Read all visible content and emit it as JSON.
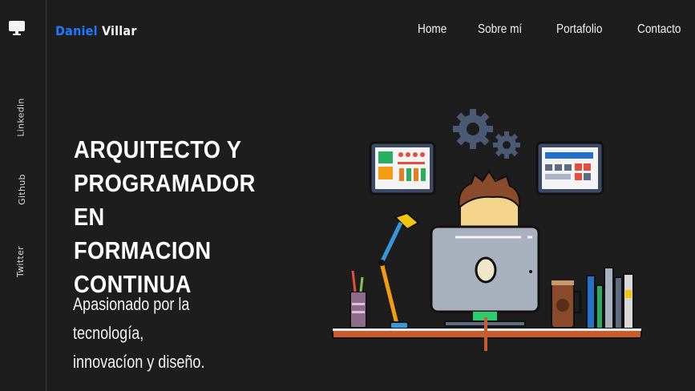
{
  "sidebar": {
    "logo_icon": "monitor-icon",
    "links": [
      {
        "label": "Linkedin"
      },
      {
        "label": "Github"
      },
      {
        "label": "Twitter"
      }
    ]
  },
  "header": {
    "brand_first": "Daniel",
    "brand_last": "Villar",
    "nav": [
      {
        "label": "Home"
      },
      {
        "label": "Sobre mí"
      },
      {
        "label": "Portafolio"
      },
      {
        "label": "Contacto"
      }
    ]
  },
  "hero": {
    "headline_lines": [
      "ARQUITECTO Y",
      "PROGRAMADOR EN",
      "FORMACION",
      "CONTINUA"
    ],
    "tagline_lines": [
      "Apasionado por la tecnología,",
      "innovacíon y diseño."
    ]
  },
  "colors": {
    "background": "#1d1d1d",
    "accent": "#1e78ff"
  }
}
